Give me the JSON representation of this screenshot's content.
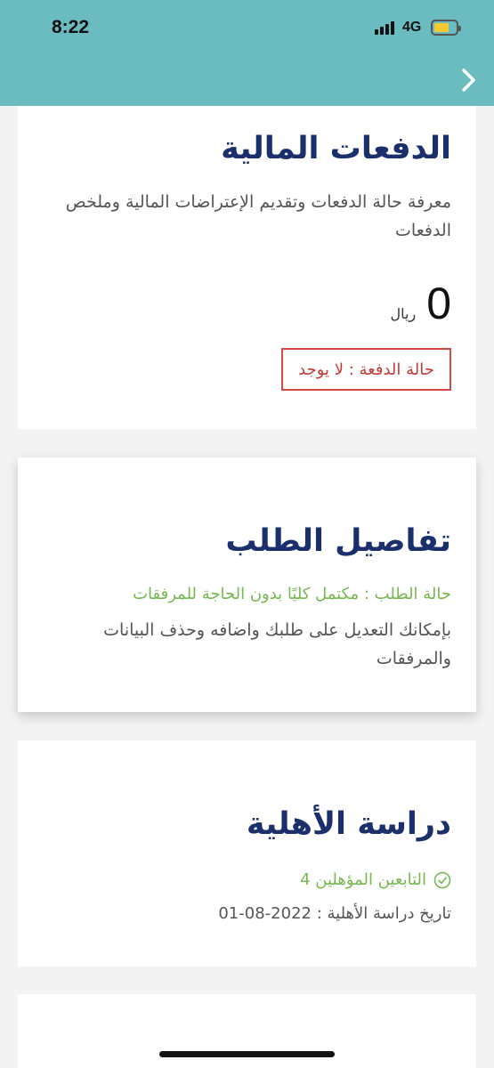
{
  "status_bar": {
    "time": "8:22",
    "network": "4G",
    "signal_icon": "cellular-signal-icon",
    "battery_icon": "battery-icon"
  },
  "header": {
    "background_color": "#6bbcc1",
    "back_icon": "chevron-right-icon"
  },
  "payments_card": {
    "title": "الدفعات المالية",
    "description": "معرفة حالة الدفعات وتقديم الإعتراضات المالية وملخص الدفعات",
    "amount": "0",
    "currency": "ريال",
    "payment_status": "حالة الدفعة : لا يوجد",
    "status_color": "#d14a44"
  },
  "request_card": {
    "title": "تفاصيل الطلب",
    "status": "حالة الطلب : مكتمل كليًا بدون الحاجة للمرفقات",
    "description": "بإمكانك التعديل على طلبك واضافه وحذف البيانات والمرفقات",
    "status_color": "#77b851"
  },
  "eligibility_card": {
    "title": "دراسة الأهلية",
    "eligible_dependents": "التابعين المؤهلين 4",
    "check_icon": "check-circle-icon",
    "study_date": "تاريخ دراسة الأهلية : 2022-08-01",
    "title_color": "#1a2f6b"
  }
}
